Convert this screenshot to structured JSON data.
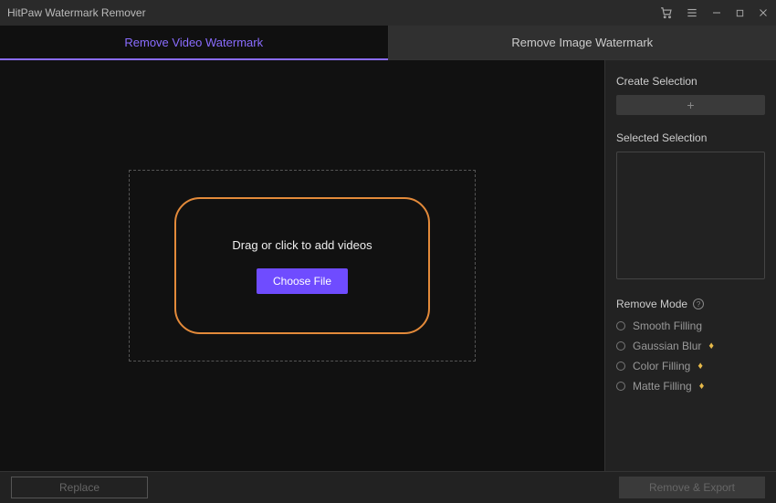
{
  "titlebar": {
    "title": "HitPaw Watermark Remover"
  },
  "tabs": {
    "video": "Remove Video Watermark",
    "image": "Remove Image Watermark"
  },
  "dropzone": {
    "text": "Drag or click to add videos",
    "button": "Choose File"
  },
  "sidebar": {
    "create_selection_label": "Create Selection",
    "create_selection_plus": "+",
    "selected_selection_label": "Selected Selection",
    "remove_mode_label": "Remove Mode",
    "help_glyph": "?",
    "modes": [
      {
        "label": "Smooth Filling",
        "premium": false
      },
      {
        "label": "Gaussian Blur",
        "premium": true
      },
      {
        "label": "Color Filling",
        "premium": true
      },
      {
        "label": "Matte Filling",
        "premium": true
      }
    ]
  },
  "footer": {
    "replace": "Replace",
    "export": "Remove & Export"
  }
}
